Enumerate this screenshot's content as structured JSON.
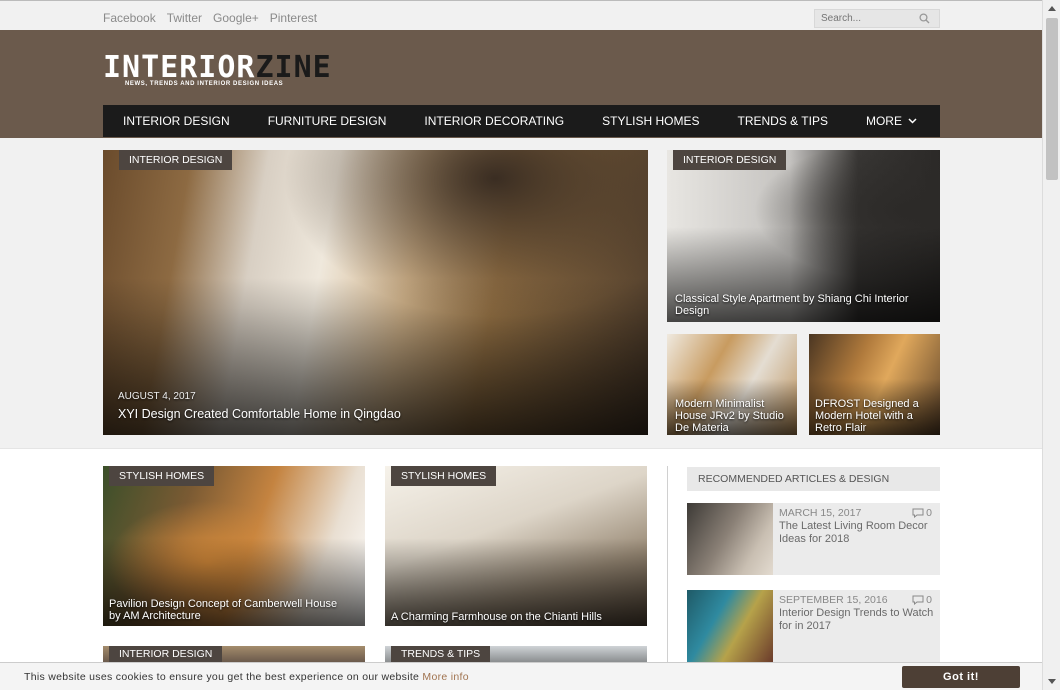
{
  "social": [
    "Facebook",
    "Twitter",
    "Google+",
    "Pinterest"
  ],
  "search": {
    "placeholder": "Search..."
  },
  "logo": {
    "main_a": "INTERIOR",
    "main_b": "ZINE",
    "tagline": "NEWS, TRENDS AND INTERIOR DESIGN IDEAS"
  },
  "nav": [
    "INTERIOR DESIGN",
    "FURNITURE DESIGN",
    "INTERIOR DECORATING",
    "STYLISH HOMES",
    "TRENDS & TIPS",
    "MORE"
  ],
  "featured": {
    "main": {
      "badge": "INTERIOR DESIGN",
      "date": "AUGUST 4, 2017",
      "title": "XYI Design Created Comfortable Home in Qingdao"
    },
    "top_right": {
      "badge": "INTERIOR DESIGN",
      "title": "Classical Style Apartment by Shiang Chi Interior Design"
    },
    "small_1": {
      "title": "Modern Minimalist House JRv2 by Studio De Materia"
    },
    "small_2": {
      "title": "DFROST Designed a Modern Hotel with a Retro Flair"
    }
  },
  "grid": [
    {
      "badge": "STYLISH HOMES",
      "title": "Pavilion Design Concept of Camberwell House by AM Architecture"
    },
    {
      "badge": "STYLISH HOMES",
      "title": "A Charming Farmhouse on the Chianti Hills"
    },
    {
      "badge": "INTERIOR DESIGN",
      "title": ""
    },
    {
      "badge": "TRENDS & TIPS",
      "title": ""
    }
  ],
  "recommended": {
    "heading": "RECOMMENDED ARTICLES & DESIGN",
    "items": [
      {
        "date": "MARCH 15, 2017",
        "comments": "0",
        "title": "The Latest Living Room Decor Ideas for 2018"
      },
      {
        "date": "SEPTEMBER 15, 2016",
        "comments": "0",
        "title": "Interior Design Trends to Watch for in 2017"
      }
    ]
  },
  "cookie": {
    "text": "This website uses cookies to ensure you get the best experience on our website",
    "link": "More info",
    "button": "Got it!"
  },
  "colors": {
    "header_bg": "#6b5a4c",
    "nav_bg": "#1b1b1b",
    "badge_bg": "#4d4540",
    "cookie_button": "#4d3f35"
  },
  "icons": {
    "search": "search-icon",
    "more": "chevron-down-icon",
    "comments": "comment-icon"
  }
}
